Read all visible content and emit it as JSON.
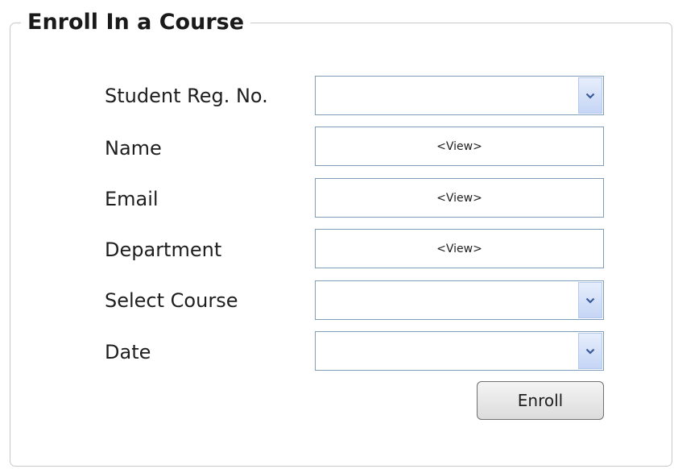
{
  "form": {
    "legend": "Enroll In a Course",
    "fields": [
      {
        "label": "Student Reg. No.",
        "type": "dropdown",
        "value": ""
      },
      {
        "label": "Name",
        "type": "view",
        "value": "<View>"
      },
      {
        "label": "Email",
        "type": "view",
        "value": "<View>"
      },
      {
        "label": "Department",
        "type": "view",
        "value": "<View>"
      },
      {
        "label": "Select Course",
        "type": "dropdown",
        "value": ""
      },
      {
        "label": "Date",
        "type": "dropdown",
        "value": ""
      }
    ],
    "submit_label": "Enroll"
  },
  "icons": {
    "dropdown": "chevron-down-icon"
  },
  "colors": {
    "field_border": "#7f9db9",
    "dropdown_button": "#c5d5f5",
    "chevron": "#3a5a9a"
  }
}
